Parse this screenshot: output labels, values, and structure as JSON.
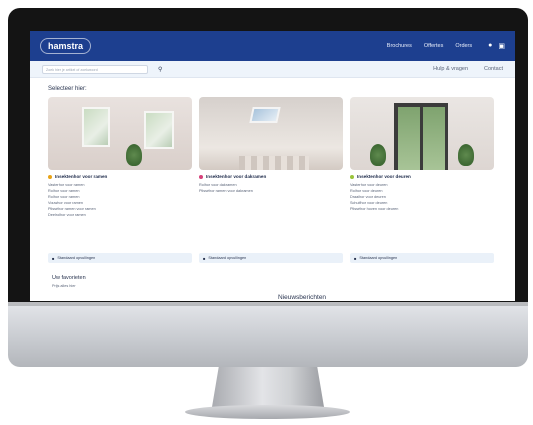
{
  "header": {
    "logo": "hamstra",
    "nav": [
      "Brochures",
      "Offertes",
      "Orders"
    ],
    "account_icon": "user-icon",
    "cart_icon": "cart-icon"
  },
  "subbar": {
    "search_placeholder": "Zoek hier je artikel of zoekwoord",
    "links": [
      "Hulp & vragen",
      "Contact"
    ]
  },
  "main": {
    "section_title": "Selecteer hier:",
    "cards": [
      {
        "title": "Insektenhor voor ramen",
        "dot_color": "#e8a317",
        "items": [
          "Vasterhor voor ramen",
          "Rolhor voor ramen",
          "Rolhor voor ramen",
          "Vouwhor voor ramen",
          "Plisséhor ramen voor ramen",
          "Deelrolhor voor ramen"
        ],
        "footer": "Standaard opvullingen"
      },
      {
        "title": "Insektenhor voor dakramen",
        "dot_color": "#d6417a",
        "items": [
          "Rolhor voor dakramen",
          "Plisséhor ramen voor dakramen"
        ],
        "footer": "Standaard opvullingen"
      },
      {
        "title": "Insektenhor voor deuren",
        "dot_color": "#9ac43a",
        "items": [
          "Vasterhor voor deuren",
          "Rolhor voor deuren",
          "Draaihor voor deuren",
          "Schuifhor voor deuren",
          "Plisséhor hoven voor deuren"
        ],
        "footer": "Standaard opvullingen"
      }
    ]
  },
  "lower": {
    "title": "Uw favorieten",
    "subtitle": "Prijs alles hier",
    "news_title": "Nieuwsberichten"
  }
}
